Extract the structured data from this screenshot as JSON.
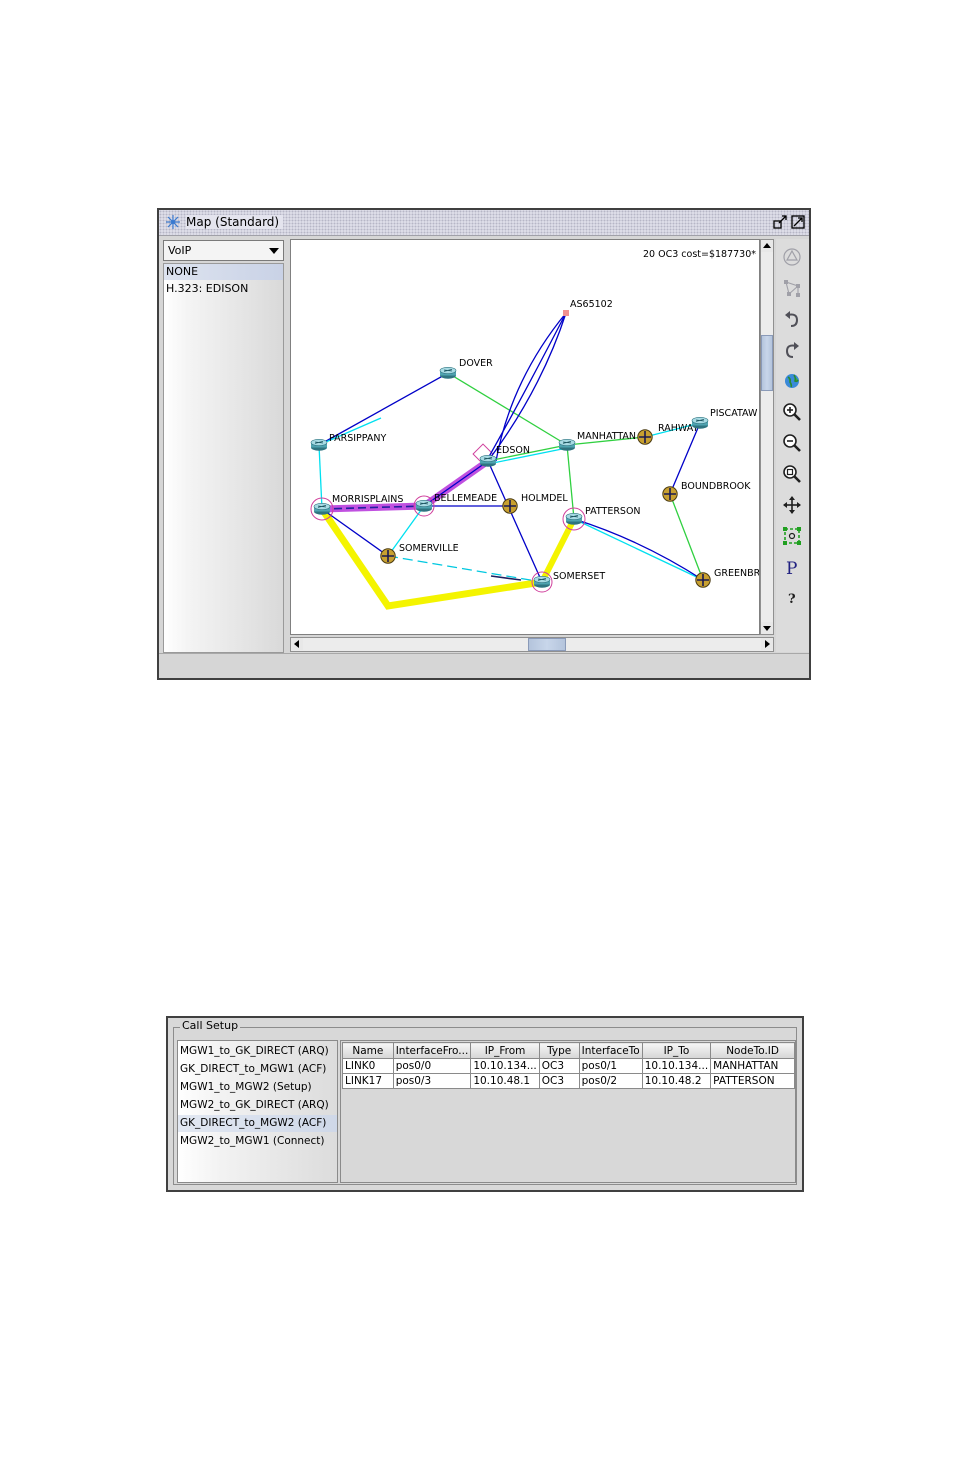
{
  "map_window": {
    "title": "Map (Standard)",
    "layer_select": {
      "value": "VoIP"
    },
    "layer_list": [
      {
        "label": "NONE",
        "selected": true
      },
      {
        "label": "H.323: EDISON",
        "selected": false
      }
    ],
    "cost_text": "20 OC3 cost=$187730*",
    "nodes": [
      {
        "name": "AS65102",
        "icon": "as-square-icon"
      },
      {
        "name": "DOVER",
        "icon": "router-icon"
      },
      {
        "name": "PARSIPPANY",
        "icon": "router-icon"
      },
      {
        "name": "EDSON",
        "icon": "router-icon"
      },
      {
        "name": "MANHATTAN",
        "icon": "router-icon"
      },
      {
        "name": "RAHWAY",
        "icon": "switch-icon"
      },
      {
        "name": "PISCATAW",
        "icon": "router-icon"
      },
      {
        "name": "MORRISPLAINS",
        "icon": "router-icon"
      },
      {
        "name": "BELLEMEADE",
        "icon": "router-icon"
      },
      {
        "name": "HOLMDEL",
        "icon": "switch-icon"
      },
      {
        "name": "PATTERSON",
        "icon": "router-icon"
      },
      {
        "name": "BOUNDBROOK",
        "icon": "switch-icon"
      },
      {
        "name": "SOMERVILLE",
        "icon": "switch-icon"
      },
      {
        "name": "SOMERSET",
        "icon": "router-icon"
      },
      {
        "name": "GREENBR",
        "icon": "switch-icon"
      }
    ],
    "toolbar": [
      "layout-icon",
      "topology-icon",
      "undo-icon",
      "redo-icon",
      "globe-icon",
      "zoom-in-icon",
      "zoom-out-icon",
      "zoom-fit-icon",
      "pan-icon",
      "select-region-icon",
      "properties-icon",
      "help-icon"
    ],
    "toolbar_text": {
      "properties": "P",
      "help": "?"
    },
    "colors": {
      "cyan": "#00e0f0",
      "blue": "#0000c8",
      "green": "#30d040",
      "yellow": "#f4f400",
      "magenta": "#c050e0",
      "node_circle": "#d0409c"
    }
  },
  "call_setup": {
    "title": "Call Setup",
    "messages": [
      {
        "label": "MGW1_to_GK_DIRECT (ARQ)",
        "selected": false
      },
      {
        "label": "GK_DIRECT_to_MGW1 (ACF)",
        "selected": false
      },
      {
        "label": "MGW1_to_MGW2 (Setup)",
        "selected": false
      },
      {
        "label": "MGW2_to_GK_DIRECT (ARQ)",
        "selected": false
      },
      {
        "label": "GK_DIRECT_to_MGW2 (ACF)",
        "selected": true
      },
      {
        "label": "MGW2_to_MGW1 (Connect)",
        "selected": false
      }
    ],
    "columns": [
      "Name",
      "InterfaceFro...",
      "IP_From",
      "Type",
      "InterfaceTo",
      "IP_To",
      "NodeTo.ID"
    ],
    "rows": [
      [
        "LINK0",
        "pos0/0",
        "10.10.134...",
        "OC3",
        "pos0/1",
        "10.10.134...",
        "MANHATTAN"
      ],
      [
        "LINK17",
        "pos0/3",
        "10.10.48.1",
        "OC3",
        "pos0/2",
        "10.10.48.2",
        "PATTERSON"
      ]
    ]
  }
}
